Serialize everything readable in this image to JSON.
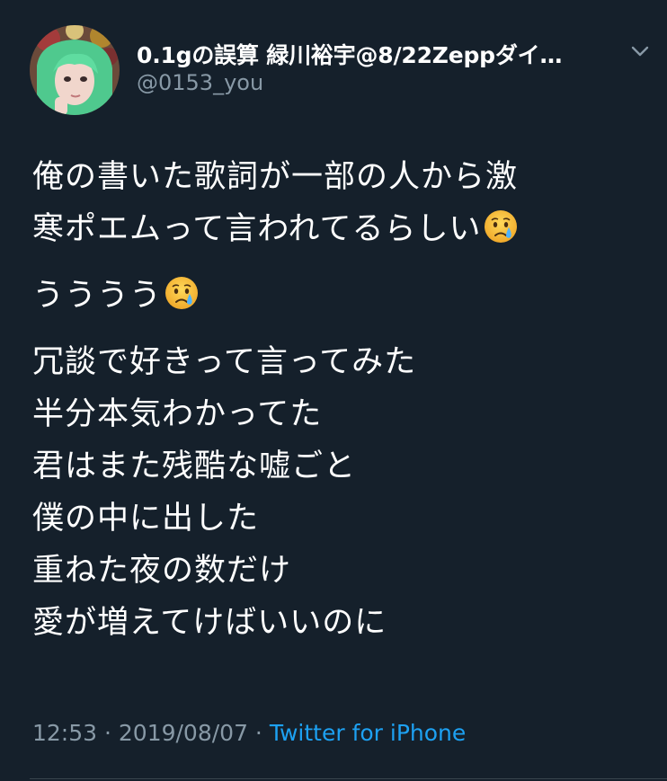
{
  "tweet": {
    "author_name": "0.1gの誤算 緑川裕宇@8/22Zeppダイ…",
    "author_handle": "@0153_you",
    "paragraphs": [
      {
        "lines": [
          "俺の書いた歌詞が一部の人から激",
          "寒ポエムって言われてるらしい"
        ]
      },
      {
        "lines": [
          "うううう"
        ]
      },
      {
        "lines": [
          "冗談で好きって言ってみた",
          "半分本気わかってた",
          "君はまた残酷な嘘ごと",
          "僕の中に出した",
          "重ねた夜の数だけ",
          "愛が増えてけばいいのに"
        ]
      }
    ],
    "emoji_name": "crying-face",
    "time": "12:53",
    "date": "2019/08/07",
    "separator": " · ",
    "source": "Twitter for iPhone"
  },
  "colors": {
    "background": "#15202b",
    "text": "#ffffff",
    "secondary": "#8899a6",
    "link": "#1da1f2"
  },
  "icons": {
    "avatar": "avatar-photo",
    "menu": "chevron-down-icon"
  }
}
